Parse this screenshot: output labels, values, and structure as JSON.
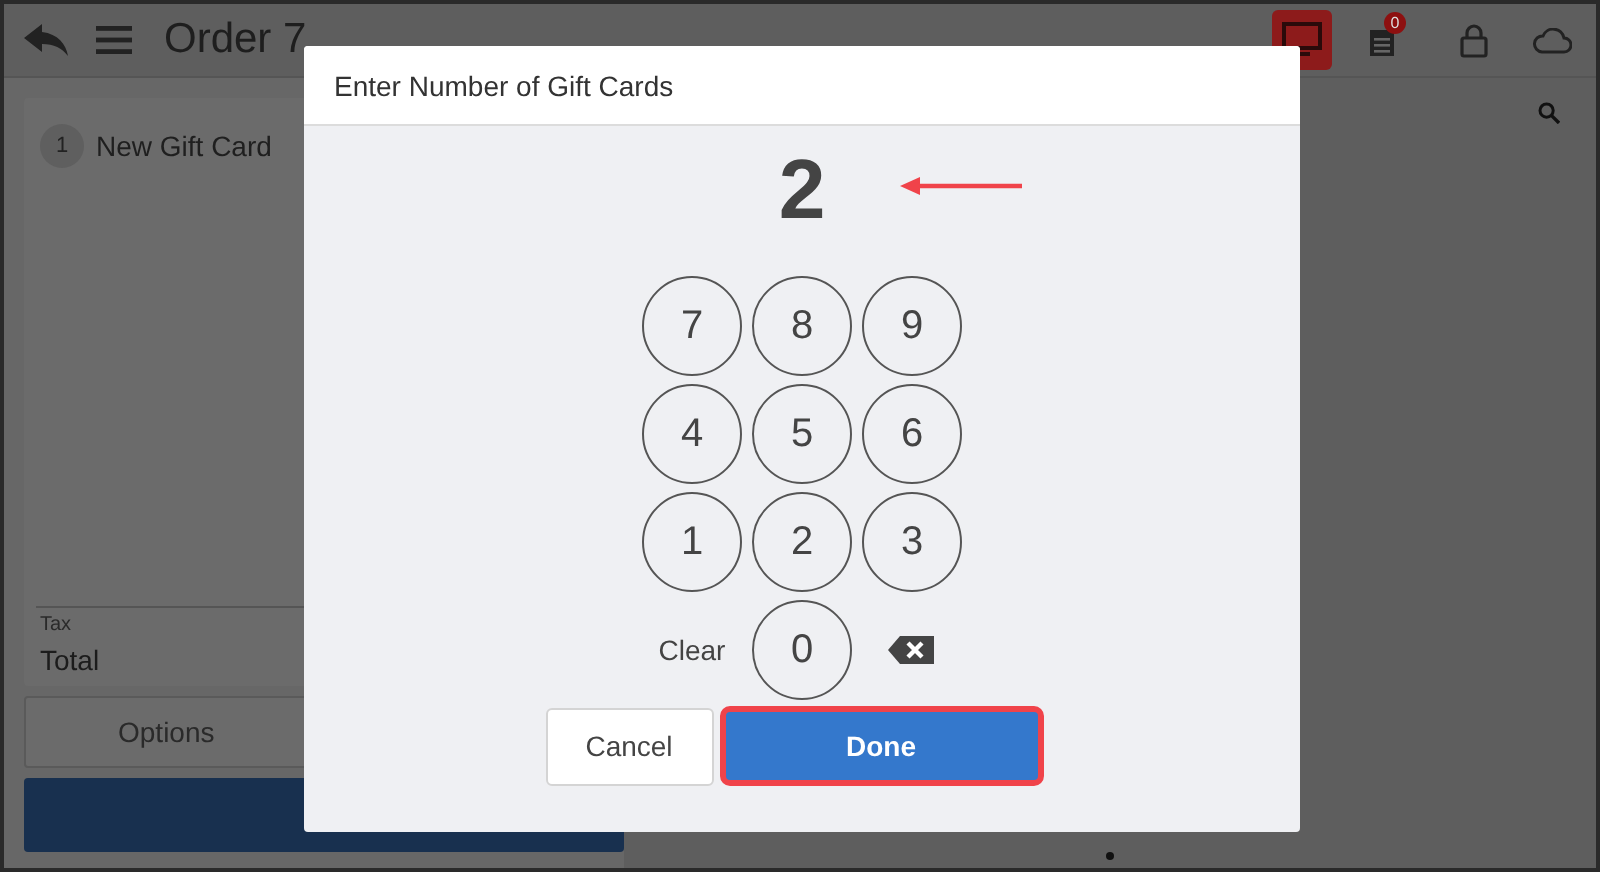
{
  "header": {
    "title": "Order 7",
    "badge": "0"
  },
  "order": {
    "items": [
      {
        "qty": "1",
        "name": "New Gift Card"
      }
    ],
    "tax_label": "Tax",
    "total_label": "Total",
    "options_button": "Options"
  },
  "dialog": {
    "title": "Enter Number of Gift Cards",
    "value": "2",
    "keys": [
      [
        {
          "kind": "digit",
          "label": "7"
        },
        {
          "kind": "digit",
          "label": "8"
        },
        {
          "kind": "digit",
          "label": "9"
        }
      ],
      [
        {
          "kind": "digit",
          "label": "4"
        },
        {
          "kind": "digit",
          "label": "5"
        },
        {
          "kind": "digit",
          "label": "6"
        }
      ],
      [
        {
          "kind": "digit",
          "label": "1"
        },
        {
          "kind": "digit",
          "label": "2"
        },
        {
          "kind": "digit",
          "label": "3"
        }
      ],
      [
        {
          "kind": "text",
          "label": "Clear"
        },
        {
          "kind": "digit",
          "label": "0"
        },
        {
          "kind": "backspace"
        }
      ]
    ],
    "cancel": "Cancel",
    "done": {
      "label": "Done",
      "highlighted": true
    }
  }
}
